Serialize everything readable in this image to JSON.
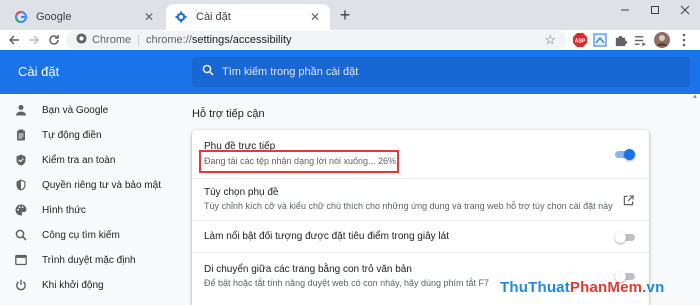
{
  "tabs": [
    {
      "label": "Google",
      "active": false,
      "icon": "google-icon"
    },
    {
      "label": "Cài đặt",
      "active": true,
      "icon": "gear-icon"
    }
  ],
  "toolbar": {
    "site_chip": "Chrome",
    "url_scheme": "chrome://",
    "url_path": "settings/accessibility",
    "extensions": [
      "abp-icon",
      "cast-icon",
      "puzzle-icon",
      "playlist-icon",
      "avatar-icon",
      "menu-dots-icon"
    ]
  },
  "header": {
    "title": "Cài đặt",
    "search_placeholder": "Tìm kiếm trong phần cài đặt"
  },
  "sidebar": {
    "items": [
      {
        "label": "Bạn và Google",
        "icon": "person-icon"
      },
      {
        "label": "Tự động điền",
        "icon": "clipboard-icon"
      },
      {
        "label": "Kiểm tra an toàn",
        "icon": "shield-check-icon"
      },
      {
        "label": "Quyền riêng tư và bảo mật",
        "icon": "shield-icon"
      },
      {
        "label": "Hình thức",
        "icon": "palette-icon"
      },
      {
        "label": "Công cụ tìm kiếm",
        "icon": "search-icon"
      },
      {
        "label": "Trình duyệt mặc định",
        "icon": "browser-icon"
      },
      {
        "label": "Khi khởi động",
        "icon": "power-icon"
      }
    ]
  },
  "main": {
    "section_title": "Hỗ trợ tiếp cận",
    "rows": [
      {
        "title": "Phụ đề trực tiếp",
        "desc": "Đang tải các tệp nhận dạng lời nói xuống... 26%",
        "control": "toggle",
        "on": true
      },
      {
        "title": "Tùy chọn phụ đề",
        "desc": "Tùy chỉnh kích cỡ và kiểu chữ chú thích cho những ứng dụng và trang web hỗ trợ tùy chọn cài đặt này",
        "control": "external-link"
      },
      {
        "title": "Làm nổi bật đối tượng được đặt tiêu điểm trong giây lát",
        "desc": "",
        "control": "toggle",
        "on": false
      },
      {
        "title": "Di chuyển giữa các trang bằng con trỏ văn bản",
        "desc": "Để bật hoặc tắt tính năng duyệt web có con nháy, hãy dùng phím tắt F7",
        "control": "toggle",
        "on": false
      }
    ]
  },
  "colors": {
    "accent": "#1a73e8",
    "highlight_box": "#e53935"
  },
  "watermark": {
    "part1": "ThuThuat",
    "part2": "PhanMem",
    "part3": ".vn"
  }
}
